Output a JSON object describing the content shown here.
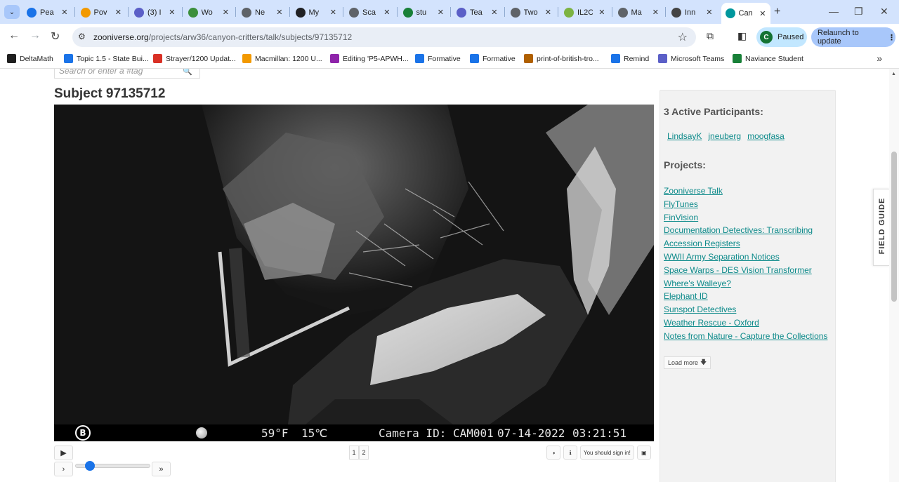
{
  "browser": {
    "tabs": [
      {
        "title": "Pea",
        "icon": "pearson-icon",
        "color": "#1a73e8"
      },
      {
        "title": "Pov",
        "icon": "powerschool-icon",
        "color": "#f29900"
      },
      {
        "title": "(3) I",
        "icon": "teams-icon",
        "color": "#5b5fc7"
      },
      {
        "title": "Wo",
        "icon": "grid-icon",
        "color": "#3c8f3c"
      },
      {
        "title": "Ne",
        "icon": "zooniverse-icon",
        "color": "#5f6368"
      },
      {
        "title": "My",
        "icon": "pmt-icon",
        "color": "#202124"
      },
      {
        "title": "Sca",
        "icon": "zooniverse-icon",
        "color": "#5f6368"
      },
      {
        "title": "stu",
        "icon": "globe-icon",
        "color": "#188038"
      },
      {
        "title": "Tea",
        "icon": "teams-icon",
        "color": "#5b5fc7"
      },
      {
        "title": "Two",
        "icon": "zooniverse-icon",
        "color": "#5f6368"
      },
      {
        "title": "IL2C",
        "icon": "plant-icon",
        "color": "#7cb342"
      },
      {
        "title": "Ma",
        "icon": "zooniverse-icon",
        "color": "#5f6368"
      },
      {
        "title": "Inn",
        "icon": "paw-icon",
        "color": "#444444"
      },
      {
        "title": "Can",
        "icon": "zooniverse-icon",
        "color": "#00979d",
        "active": true
      }
    ],
    "url_domain": "zooniverse.org",
    "url_path": "/projects/arw36/canyon-critters/talk/subjects/97135712",
    "profile_initial": "C",
    "profile_status": "Paused",
    "relaunch_label": "Relaunch to update",
    "bookmarks": [
      {
        "label": "DeltaMath",
        "icon": "deltamath-icon",
        "color": "#1f1f1f"
      },
      {
        "label": "Topic 1.5 - State Bui...",
        "icon": "cloud-icon",
        "color": "#1a73e8"
      },
      {
        "label": "Strayer/1200 Updat...",
        "icon": "flame-icon",
        "color": "#d93025"
      },
      {
        "label": "Macmillan: 1200 U...",
        "icon": "lightbulb-icon",
        "color": "#f29900"
      },
      {
        "label": "Editing 'P5-APWH...",
        "icon": "form-icon",
        "color": "#8e24aa"
      },
      {
        "label": "Formative",
        "icon": "check-icon",
        "color": "#1a73e8"
      },
      {
        "label": "Formative",
        "icon": "check-icon",
        "color": "#1a73e8"
      },
      {
        "label": "print-of-british-tro...",
        "icon": "image-icon",
        "color": "#b06000"
      },
      {
        "label": "Remind",
        "icon": "remind-icon",
        "color": "#1a73e8"
      },
      {
        "label": "Microsoft Teams",
        "icon": "teams-icon",
        "color": "#5b5fc7"
      },
      {
        "label": "Naviance Student",
        "icon": "globe-icon",
        "color": "#188038"
      }
    ],
    "bookmarks_more": "»"
  },
  "page": {
    "search_placeholder": "Search or enter a #tag",
    "subject_title": "Subject 97135712",
    "camera_overlay": {
      "logo": "B",
      "temp_f": "59°F",
      "temp_c": "15℃",
      "camera_id": "Camera ID: CAM001",
      "date": "07-14-2022",
      "time": "03:21:51"
    },
    "player": {
      "play_symbol": "▶",
      "next_symbol": "›",
      "fast_symbol": "»",
      "slider_fraction": 0.14,
      "pages": [
        "1",
        "2"
      ]
    },
    "image_tools": {
      "sign_in_label": "You should sign in!"
    },
    "sidebar": {
      "participants_heading": "3 Active Participants:",
      "participants": [
        "LindsayK",
        "jneuberg",
        "moogfasa"
      ],
      "projects_heading": "Projects:",
      "projects": [
        "Zooniverse Talk",
        "FlyTunes",
        "FinVision",
        "Documentation Detectives: Transcribing Accession Registers",
        "WWII Army Separation Notices",
        "Space Warps - DES Vision Transformer",
        "Where's Walleye?",
        "Elephant ID",
        "Sunspot Detectives",
        "Weather Rescue - Oxford",
        "Notes from Nature - Capture the Collections"
      ],
      "load_more_label": "Load more"
    },
    "field_guide_label": "FIELD GUIDE"
  }
}
